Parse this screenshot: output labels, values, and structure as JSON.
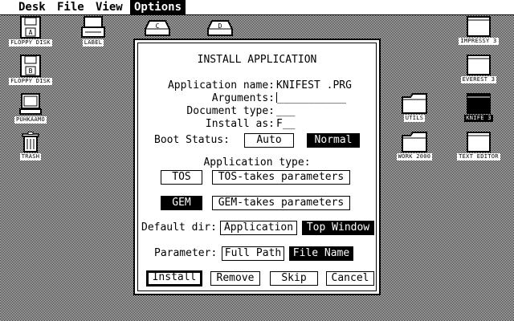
{
  "menubar": {
    "items": [
      {
        "label": "Desk"
      },
      {
        "label": "File"
      },
      {
        "label": "View"
      },
      {
        "label": "Options"
      }
    ]
  },
  "desktop_icons": [
    {
      "label": "FLOPPY DISK",
      "glyph": "A",
      "icon": "floppy-disk-icon"
    },
    {
      "label": "LABEL",
      "glyph": "",
      "icon": "printer-icon"
    },
    {
      "label": "FLOPPY DISK",
      "glyph": "B",
      "icon": "floppy-disk-icon"
    },
    {
      "label": "PUHKAAMO",
      "glyph": "",
      "icon": "computer-icon"
    },
    {
      "label": "TRASH",
      "glyph": "",
      "icon": "trash-can-icon"
    },
    {
      "label": "",
      "glyph": "C",
      "icon": "hard-disk-icon"
    },
    {
      "label": "",
      "glyph": "D",
      "icon": "hard-disk-icon"
    },
    {
      "label": "IMPRESSY 3",
      "glyph": "",
      "icon": "window-icon"
    },
    {
      "label": "EVEREST 3",
      "glyph": "",
      "icon": "window-icon"
    },
    {
      "label": "UTILS",
      "glyph": "",
      "icon": "folder-icon"
    },
    {
      "label": "KNIFE 3",
      "glyph": "",
      "icon": "window-icon"
    },
    {
      "label": "WORK 2000",
      "glyph": "",
      "icon": "folder-icon"
    },
    {
      "label": "TEXT EDITOR",
      "glyph": "",
      "icon": "window-icon"
    }
  ],
  "dialog": {
    "title": "INSTALL APPLICATION",
    "app_name_label": "Application name:",
    "app_name_value": "KNIFEST .PRG",
    "arguments_label": "Arguments:",
    "arguments_value": "___________",
    "doctype_label": "Document type:",
    "doctype_value": "___",
    "install_as_label": "Install as:",
    "install_as_value": "F__",
    "boot_status_label": "Boot Status:",
    "boot_auto": "Auto",
    "boot_normal": "Normal",
    "app_type_label": "Application type:",
    "type_tos": "TOS",
    "type_tos_params": "TOS-takes parameters",
    "type_gem": "GEM",
    "type_gem_params": "GEM-takes parameters",
    "default_dir_label": "Default dir:",
    "dir_application": "Application",
    "dir_top_window": "Top Window",
    "parameter_label": "Parameter:",
    "param_full_path": "Full Path",
    "param_file_name": "File Name",
    "btn_install": "Install",
    "btn_remove": "Remove",
    "btn_skip": "Skip",
    "btn_cancel": "Cancel"
  }
}
